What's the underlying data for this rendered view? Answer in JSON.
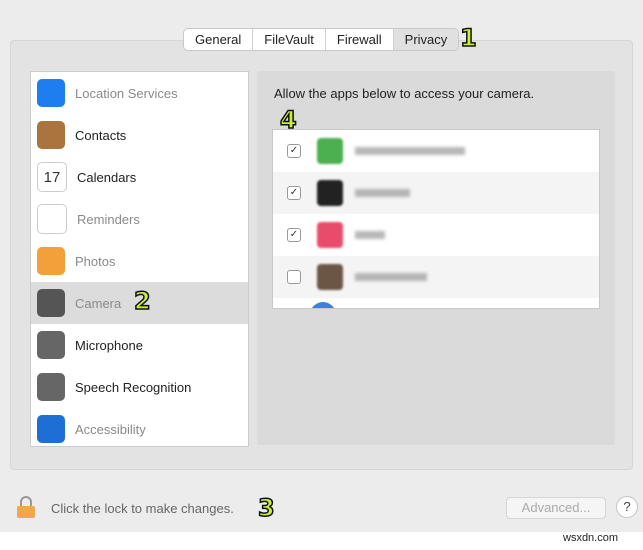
{
  "tabs": [
    {
      "label": "General",
      "selected": false
    },
    {
      "label": "FileVault",
      "selected": false
    },
    {
      "label": "Firewall",
      "selected": false
    },
    {
      "label": "Privacy",
      "selected": true
    }
  ],
  "sidebar": {
    "items": [
      {
        "label": "Location Services",
        "icon": "location-arrow-icon",
        "color": "#1e7ef0",
        "dim": true
      },
      {
        "label": "Contacts",
        "icon": "contacts-book-icon",
        "color": "#a9743e",
        "dim": false
      },
      {
        "label": "Calendars",
        "icon": "calendar-icon",
        "color": "#ffffff",
        "dim": false,
        "glyph": "17"
      },
      {
        "label": "Reminders",
        "icon": "reminders-list-icon",
        "color": "#ffffff",
        "dim": true
      },
      {
        "label": "Photos",
        "icon": "photos-flower-icon",
        "color": "#f2a03a",
        "dim": true
      },
      {
        "label": "Camera",
        "icon": "camera-icon",
        "color": "#555555",
        "dim": true,
        "selected": true
      },
      {
        "label": "Microphone",
        "icon": "microphone-waveform-icon",
        "color": "#666666",
        "dim": false
      },
      {
        "label": "Speech Recognition",
        "icon": "speech-waveform-icon",
        "color": "#666666",
        "dim": false
      },
      {
        "label": "Accessibility",
        "icon": "accessibility-icon",
        "color": "#1d6fd6",
        "dim": true
      }
    ]
  },
  "main": {
    "description": "Allow the apps below to access your camera.",
    "apps": [
      {
        "checked": true,
        "color": "#4caf50"
      },
      {
        "checked": true,
        "color": "#222222"
      },
      {
        "checked": true,
        "color": "#e94c6b"
      },
      {
        "checked": false,
        "color": "#6b5544"
      }
    ]
  },
  "footer": {
    "lock_text": "Click the lock to make changes.",
    "advanced_label": "Advanced...",
    "help_label": "?"
  },
  "annotations": [
    "1",
    "2",
    "3",
    "4"
  ],
  "watermark": "wsxdn.com"
}
